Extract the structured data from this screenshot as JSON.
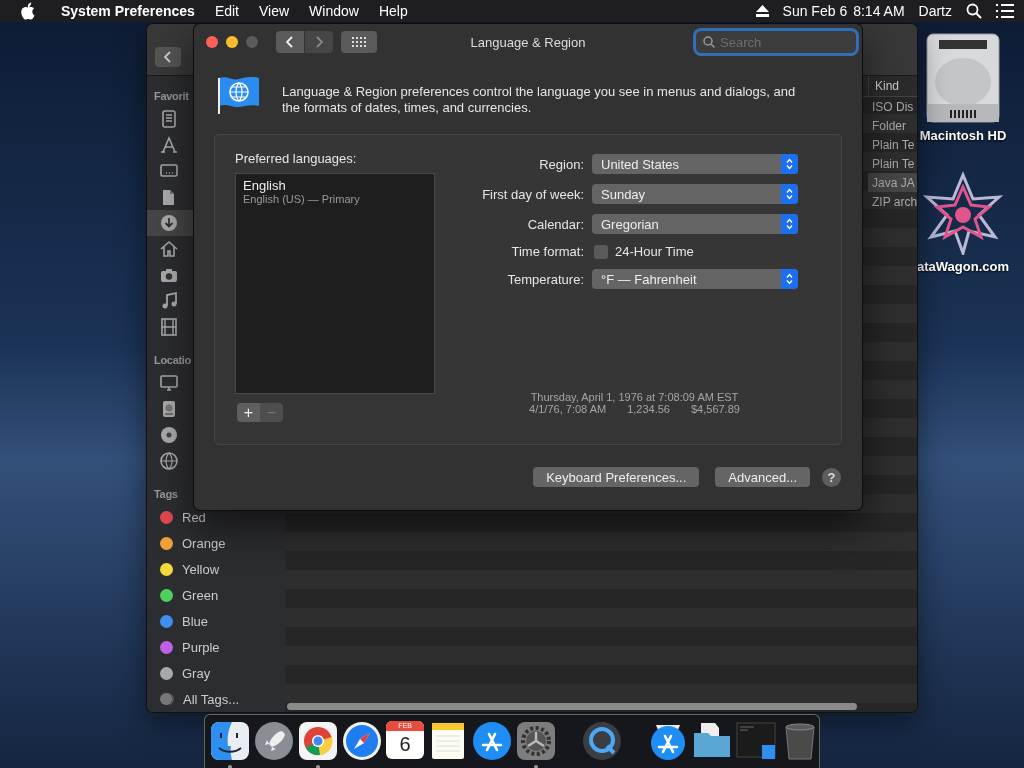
{
  "menu_bar": {
    "app_name": "System Preferences",
    "menus": [
      "Edit",
      "View",
      "Window",
      "Help"
    ],
    "date": "Sun Feb 6",
    "time": "8:14 AM",
    "user": "Dartz"
  },
  "desktop_icons": [
    {
      "kind": "drive",
      "label": "Macintosh HD"
    },
    {
      "kind": "star",
      "label": "ataWagon.com"
    }
  ],
  "finder": {
    "sections": [
      {
        "title": "Favorit",
        "items": [
          {
            "kind": "recents",
            "selected": false
          },
          {
            "kind": "applications",
            "selected": false
          },
          {
            "kind": "desktop",
            "selected": false
          },
          {
            "kind": "documents",
            "selected": false
          },
          {
            "kind": "downloads",
            "selected": true
          },
          {
            "kind": "home",
            "selected": false
          },
          {
            "kind": "pictures",
            "selected": false
          },
          {
            "kind": "music",
            "selected": false
          },
          {
            "kind": "movies",
            "selected": false
          }
        ]
      },
      {
        "title": "Locatio",
        "items": [
          {
            "kind": "computer",
            "selected": false
          },
          {
            "kind": "disk",
            "selected": false
          },
          {
            "kind": "disc",
            "selected": false
          },
          {
            "kind": "network",
            "selected": false
          }
        ]
      }
    ],
    "tags_title": "Tags",
    "tags": [
      {
        "name": "Red",
        "color": "#e5474f"
      },
      {
        "name": "Orange",
        "color": "#f0a33a"
      },
      {
        "name": "Yellow",
        "color": "#f5d93a"
      },
      {
        "name": "Green",
        "color": "#4ed15a"
      },
      {
        "name": "Blue",
        "color": "#3f8ff0"
      },
      {
        "name": "Purple",
        "color": "#c060e8"
      },
      {
        "name": "Gray",
        "color": "#a9a9ad"
      }
    ],
    "all_tags": "All Tags...",
    "column_header": "Kind",
    "rows": [
      {
        "kind_text": "ISO Dis",
        "selected": false
      },
      {
        "kind_text": "Folder",
        "selected": false
      },
      {
        "kind_text": "Plain Te",
        "selected": false
      },
      {
        "kind_text": "Plain Te",
        "selected": false
      },
      {
        "kind_text": "Java JA",
        "selected": true
      },
      {
        "kind_text": "ZIP arch",
        "selected": false
      }
    ]
  },
  "prefs": {
    "title": "Language & Region",
    "search_placeholder": "Search",
    "description": "Language & Region preferences control the language you see in menus and dialogs, and the formats of dates, times, and currencies.",
    "languages_label": "Preferred languages:",
    "languages": [
      {
        "name": "English",
        "detail": "English (US) — Primary",
        "selected": false
      }
    ],
    "add": "+",
    "remove": "−",
    "settings": [
      {
        "kind": "popup",
        "label": "Region:",
        "value": "United States"
      },
      {
        "kind": "popup",
        "label": "First day of week:",
        "value": "Sunday"
      },
      {
        "kind": "popup",
        "label": "Calendar:",
        "value": "Gregorian"
      },
      {
        "kind": "checkbox",
        "label": "Time format:",
        "text": "24-Hour Time",
        "checked": false
      },
      {
        "kind": "popup",
        "label": "Temperature:",
        "value": "°F — Fahrenheit"
      }
    ],
    "sample_date": "Thursday, April 1, 1976 at 7:08:09 AM EST",
    "sample_formats": [
      "4/1/76, 7:08 AM",
      "1,234.56",
      "$4,567.89"
    ],
    "buttons": [
      "Keyboard Preferences...",
      "Advanced..."
    ],
    "help": "?"
  },
  "dock": [
    {
      "kind": "finder",
      "running": true
    },
    {
      "kind": "launchpad",
      "running": false
    },
    {
      "kind": "chrome",
      "running": true
    },
    {
      "kind": "safari",
      "running": false
    },
    {
      "kind": "calendar",
      "running": false,
      "month": "FEB",
      "day": "6"
    },
    {
      "kind": "notes",
      "running": false
    },
    {
      "kind": "appstore",
      "running": false
    },
    {
      "kind": "sysprefs",
      "running": true
    },
    {
      "kind": "separator"
    },
    {
      "kind": "quicktime",
      "running": false
    },
    {
      "kind": "separator"
    },
    {
      "kind": "appfolder",
      "running": false
    },
    {
      "kind": "folder",
      "running": false
    },
    {
      "kind": "screenshot",
      "running": false
    },
    {
      "kind": "trash",
      "running": false
    }
  ]
}
